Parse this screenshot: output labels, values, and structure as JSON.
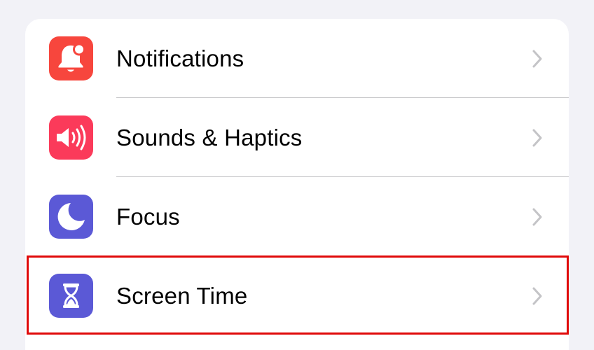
{
  "settings": {
    "items": [
      {
        "label": "Notifications",
        "icon": "bell-badge-icon",
        "icon_color": "#f7463d"
      },
      {
        "label": "Sounds & Haptics",
        "icon": "speaker-wave-icon",
        "icon_color": "#fb3a5a"
      },
      {
        "label": "Focus",
        "icon": "moon-icon",
        "icon_color": "#5b59d6"
      },
      {
        "label": "Screen Time",
        "icon": "hourglass-icon",
        "icon_color": "#5b59d6"
      }
    ]
  },
  "highlight": {
    "target": "Screen Time",
    "color": "#e00a0a"
  },
  "colors": {
    "background": "#f2f2f7",
    "card": "#ffffff",
    "separator": "#c6c6c8",
    "chevron": "#c4c4c7"
  }
}
